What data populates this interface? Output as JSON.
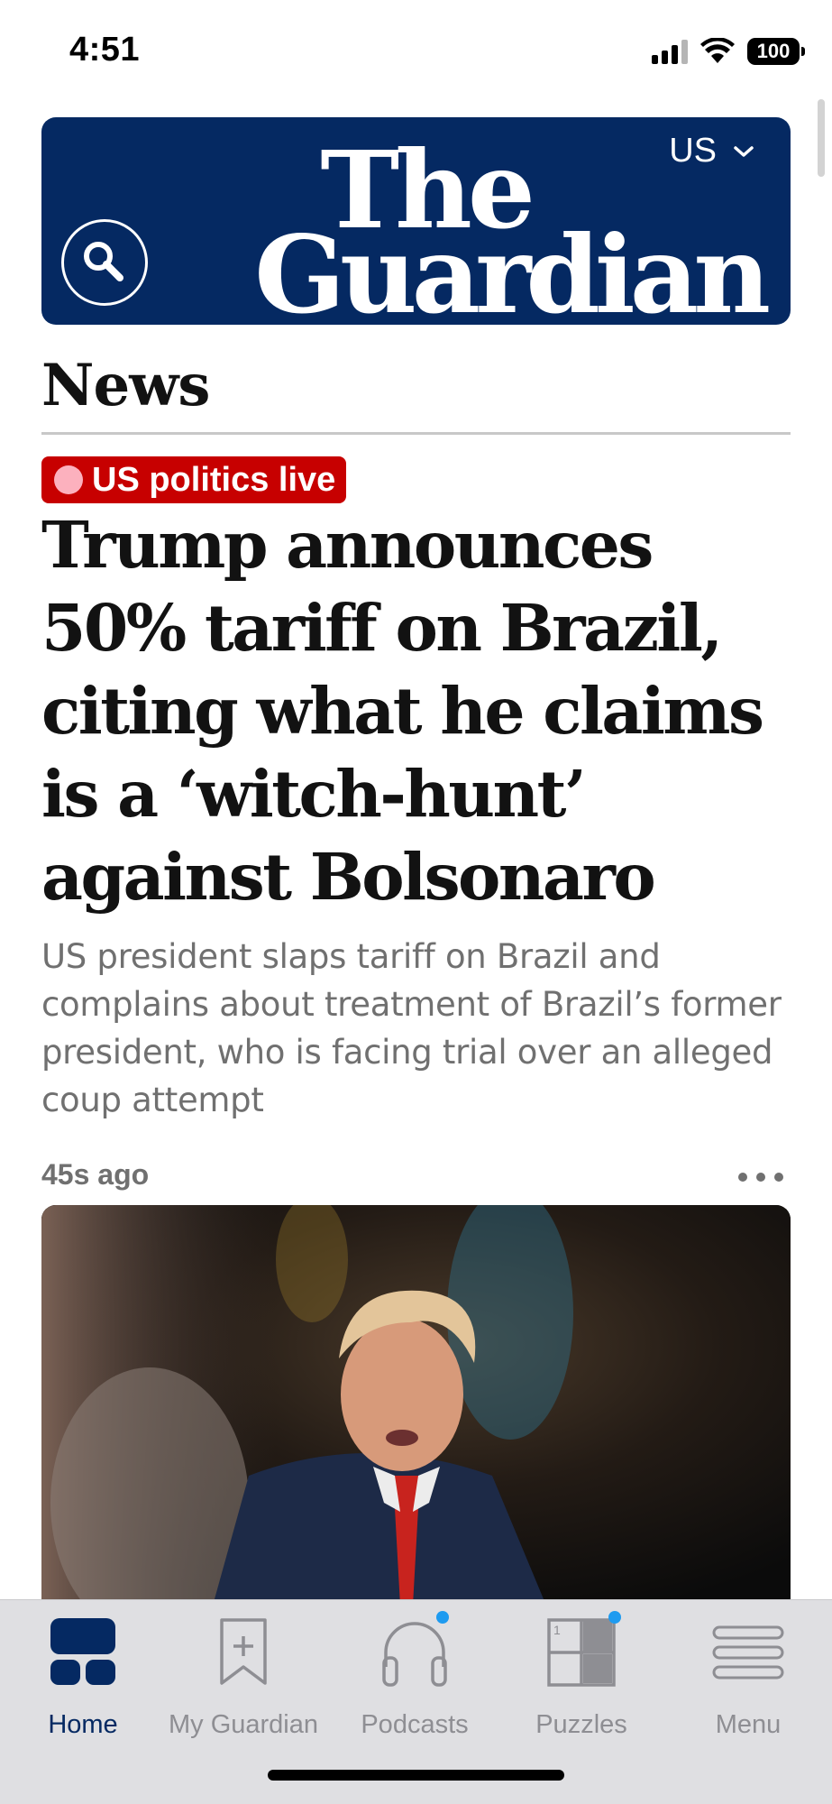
{
  "status_bar": {
    "time": "4:51",
    "battery": "100",
    "icons": [
      "signal-icon",
      "wifi-icon",
      "battery-icon"
    ]
  },
  "masthead": {
    "logo_line1": "The",
    "logo_line2": "Guardian",
    "edition": "US",
    "background": "#052962"
  },
  "section": {
    "title": "News"
  },
  "article": {
    "kicker": "US politics live",
    "kicker_color": "#c70000",
    "headline": "Trump announces 50% tariff on Brazil, citing what he claims is a ‘witch-hunt’ against Bolsonaro",
    "standfirst": "US president slaps tariff on Brazil and complains about treatment of Brazil’s former president, who is facing trial over an alleged coup attempt",
    "timestamp": "45s ago"
  },
  "tabbar": {
    "tabs": [
      {
        "label": "Home",
        "icon": "home-icon",
        "active": true
      },
      {
        "label": "My Guardian",
        "icon": "bookmark-add-icon",
        "active": false
      },
      {
        "label": "Podcasts",
        "icon": "headphones-icon",
        "active": false,
        "badge": true
      },
      {
        "label": "Puzzles",
        "icon": "crossword-icon",
        "active": false,
        "badge": true
      },
      {
        "label": "Menu",
        "icon": "menu-icon",
        "active": false
      }
    ]
  }
}
